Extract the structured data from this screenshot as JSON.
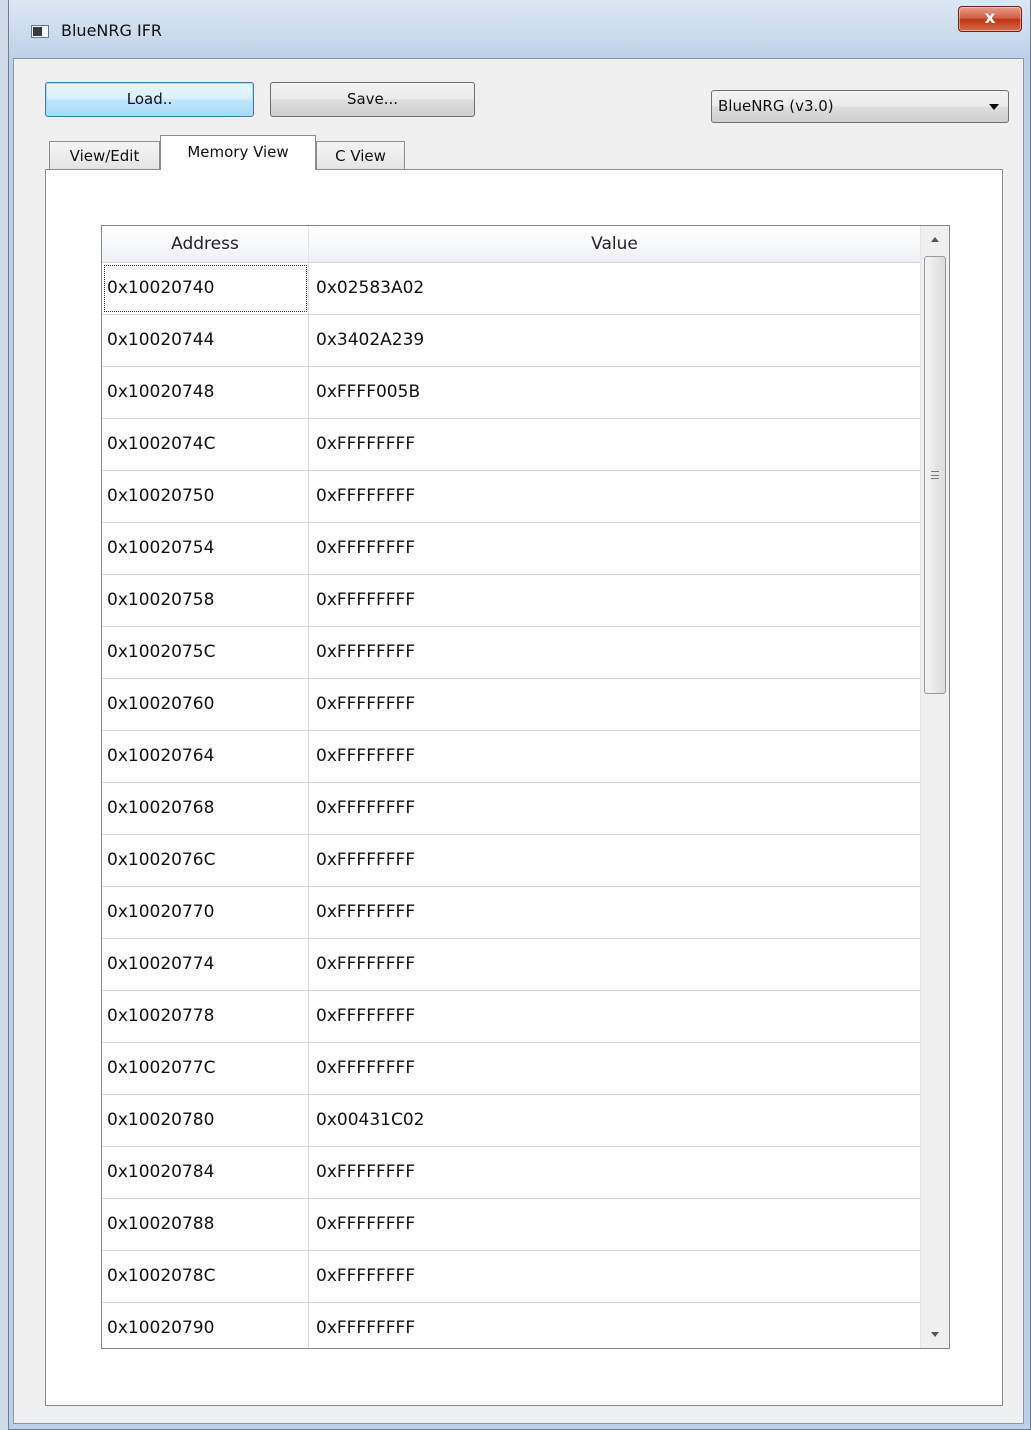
{
  "window": {
    "title": "BlueNRG IFR",
    "close_label": "x"
  },
  "toolbar": {
    "load_label": "Load..",
    "save_label": "Save...",
    "device_select": {
      "selected": "BlueNRG (v3.0)"
    }
  },
  "tabs": [
    {
      "label": "View/Edit",
      "active": false
    },
    {
      "label": "Memory View",
      "active": true
    },
    {
      "label": "C View",
      "active": false
    }
  ],
  "table": {
    "columns": [
      "Address",
      "Value"
    ],
    "rows": [
      {
        "address": "0x10020740",
        "value": "0x02583A02"
      },
      {
        "address": "0x10020744",
        "value": "0x3402A239"
      },
      {
        "address": "0x10020748",
        "value": "0xFFFF005B"
      },
      {
        "address": "0x1002074C",
        "value": "0xFFFFFFFF"
      },
      {
        "address": "0x10020750",
        "value": "0xFFFFFFFF"
      },
      {
        "address": "0x10020754",
        "value": "0xFFFFFFFF"
      },
      {
        "address": "0x10020758",
        "value": "0xFFFFFFFF"
      },
      {
        "address": "0x1002075C",
        "value": "0xFFFFFFFF"
      },
      {
        "address": "0x10020760",
        "value": "0xFFFFFFFF"
      },
      {
        "address": "0x10020764",
        "value": "0xFFFFFFFF"
      },
      {
        "address": "0x10020768",
        "value": "0xFFFFFFFF"
      },
      {
        "address": "0x1002076C",
        "value": "0xFFFFFFFF"
      },
      {
        "address": "0x10020770",
        "value": "0xFFFFFFFF"
      },
      {
        "address": "0x10020774",
        "value": "0xFFFFFFFF"
      },
      {
        "address": "0x10020778",
        "value": "0xFFFFFFFF"
      },
      {
        "address": "0x1002077C",
        "value": "0xFFFFFFFF"
      },
      {
        "address": "0x10020780",
        "value": "0x00431C02"
      },
      {
        "address": "0x10020784",
        "value": "0xFFFFFFFF"
      },
      {
        "address": "0x10020788",
        "value": "0xFFFFFFFF"
      },
      {
        "address": "0x1002078C",
        "value": "0xFFFFFFFF"
      },
      {
        "address": "0x10020790",
        "value": "0xFFFFFFFF"
      }
    ]
  }
}
